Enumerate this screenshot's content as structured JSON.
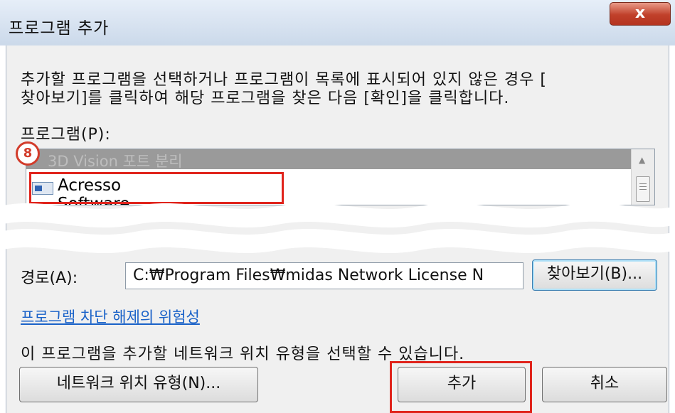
{
  "dialog": {
    "title": "프로그램 추가",
    "close_label": "x",
    "description_line1": "추가할 프로그램을 선택하거나 프로그램이 목록에 표시되어 있지 않은 경우 [",
    "description_line2": "찾아보기]를 클릭하여 해당 프로그램을 찾은 다음 [확인]을 클릭합니다.",
    "program_label": "프로그램(P):",
    "program_list": {
      "items": [
        {
          "label": "3D Vision 포트 분리",
          "icon": "program-icon",
          "state": "selected"
        },
        {
          "label": "Acresso Software Inc.",
          "icon": "program-icon",
          "state": "normal"
        }
      ]
    },
    "path_label": "경로(A):",
    "path_value": "C:₩Program Files₩midas Network License N",
    "browse_button": "찾아보기(B)...",
    "risk_link": "프로그램 차단 해제의 위험성",
    "network_info": "이 프로그램을 추가할 네트워크 위치 유형을 선택할 수 있습니다.",
    "network_location_button": "네트워크 위치 유형(N)...",
    "add_button": "추가",
    "cancel_button": "취소"
  },
  "annotation": {
    "step_number": "8",
    "highlight_color": "#e0241c"
  }
}
